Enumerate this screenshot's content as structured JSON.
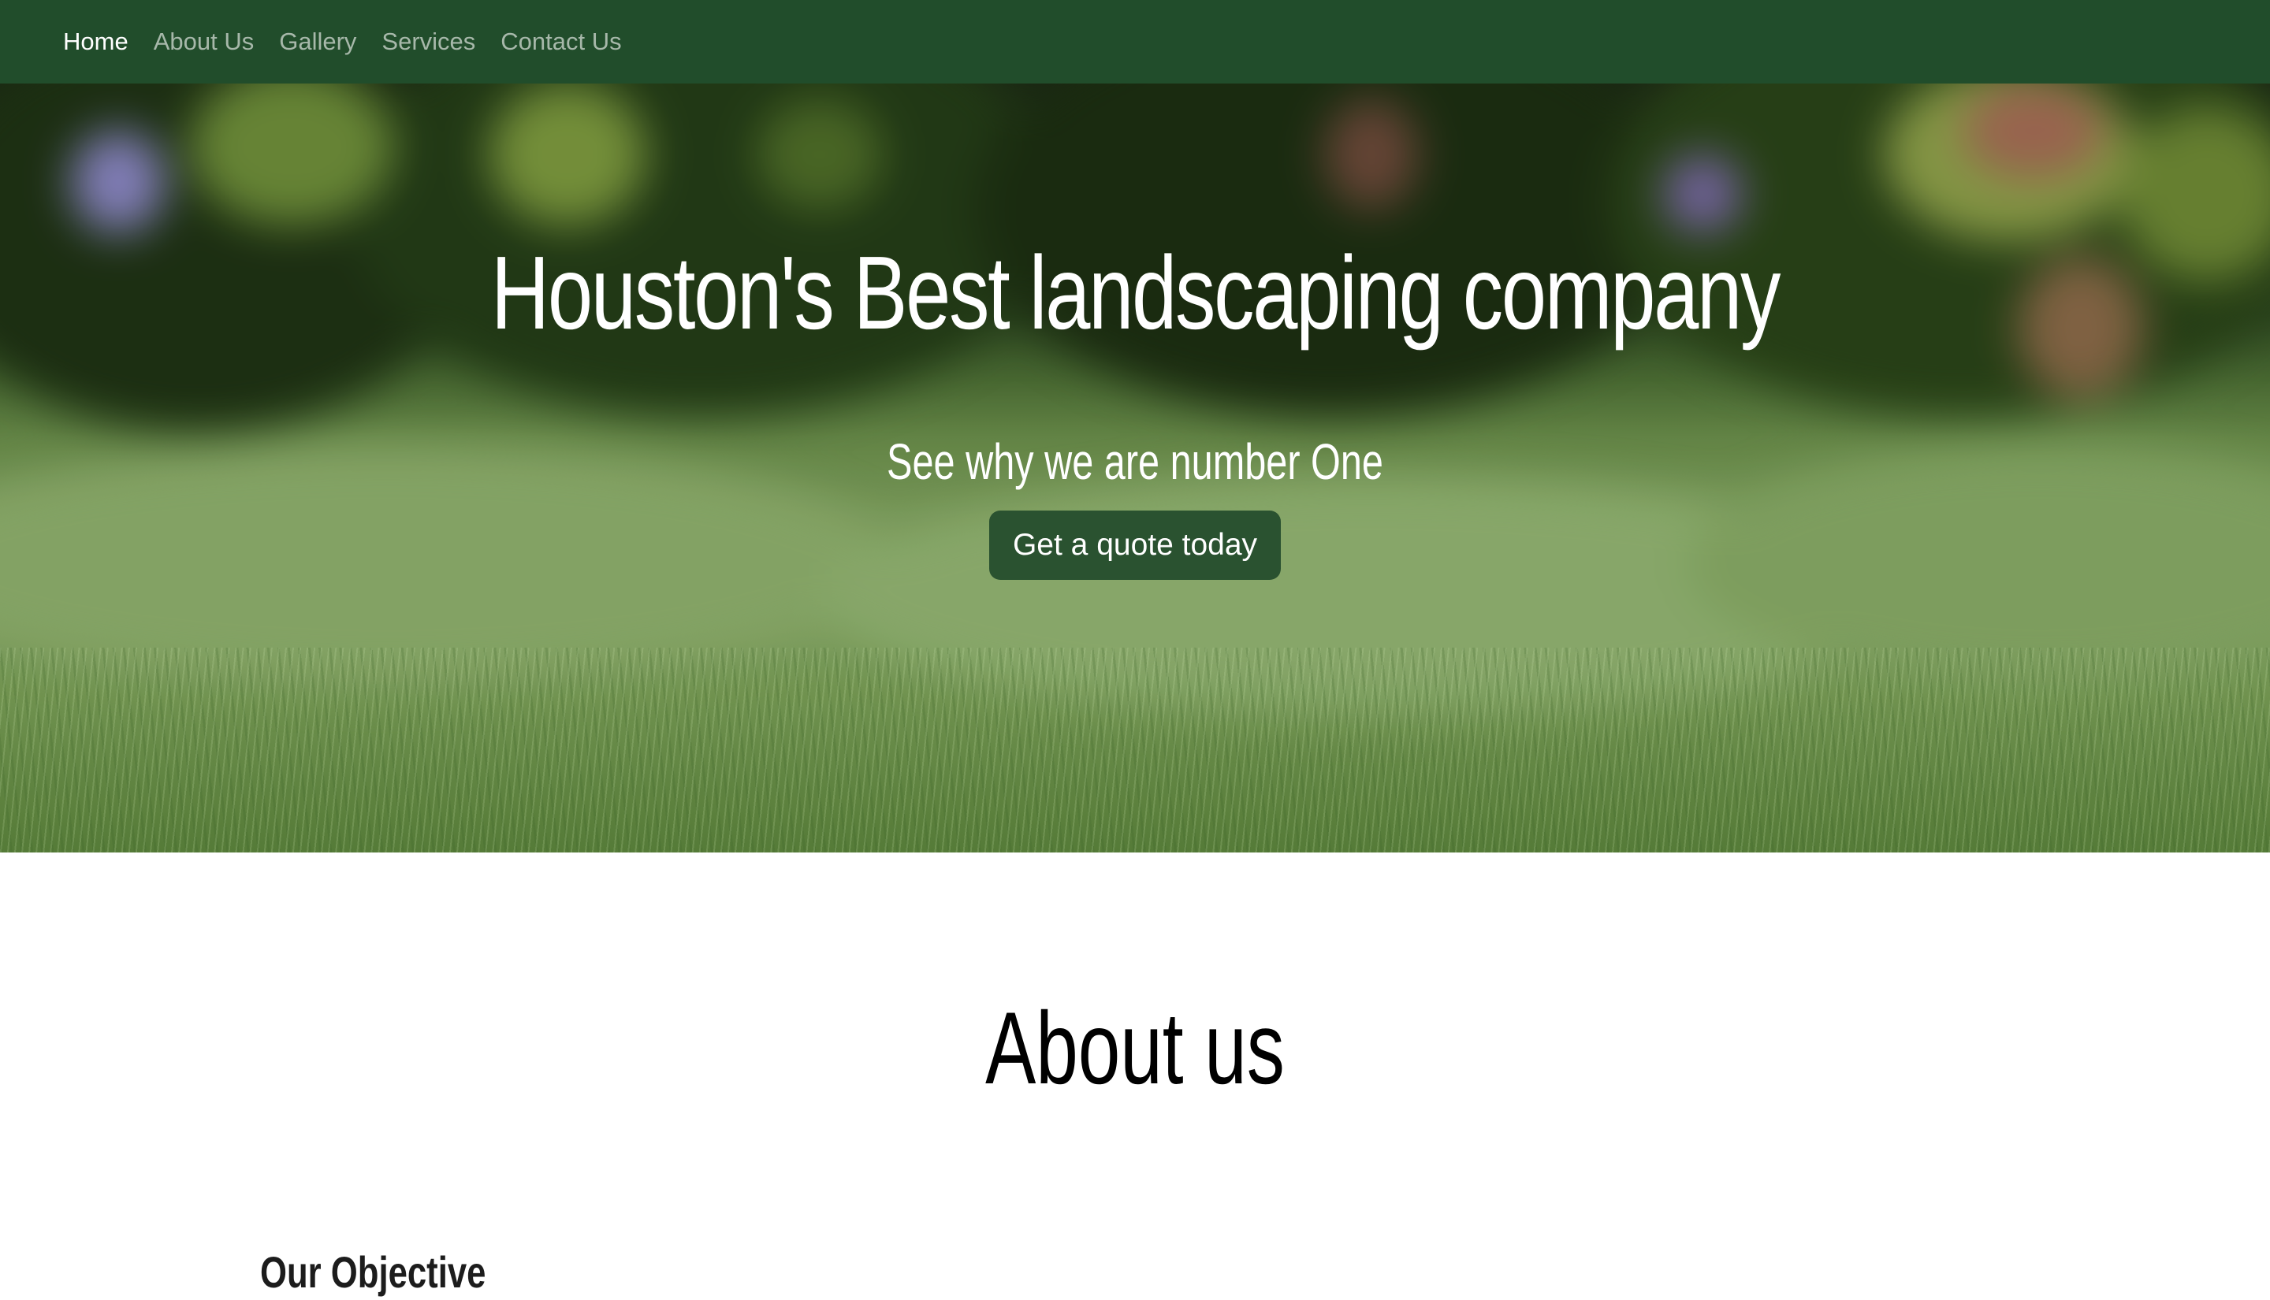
{
  "nav": {
    "items": [
      {
        "label": "Home",
        "active": true
      },
      {
        "label": "About Us",
        "active": false
      },
      {
        "label": "Gallery",
        "active": false
      },
      {
        "label": "Services",
        "active": false
      },
      {
        "label": "Contact Us",
        "active": false
      }
    ]
  },
  "hero": {
    "title": "Houston's Best landscaping company",
    "subtitle": "See why we are number One",
    "cta_label": "Get a quote today"
  },
  "about": {
    "heading": "About us",
    "objective_heading": "Our Objective"
  },
  "colors": {
    "navbar_bg": "#214d2b",
    "nav_active": "#ffffff",
    "nav_inactive": "#a7b8aa",
    "cta_bg": "#2a5230",
    "hero_text": "#ffffff",
    "page_bg": "#ffffff"
  }
}
